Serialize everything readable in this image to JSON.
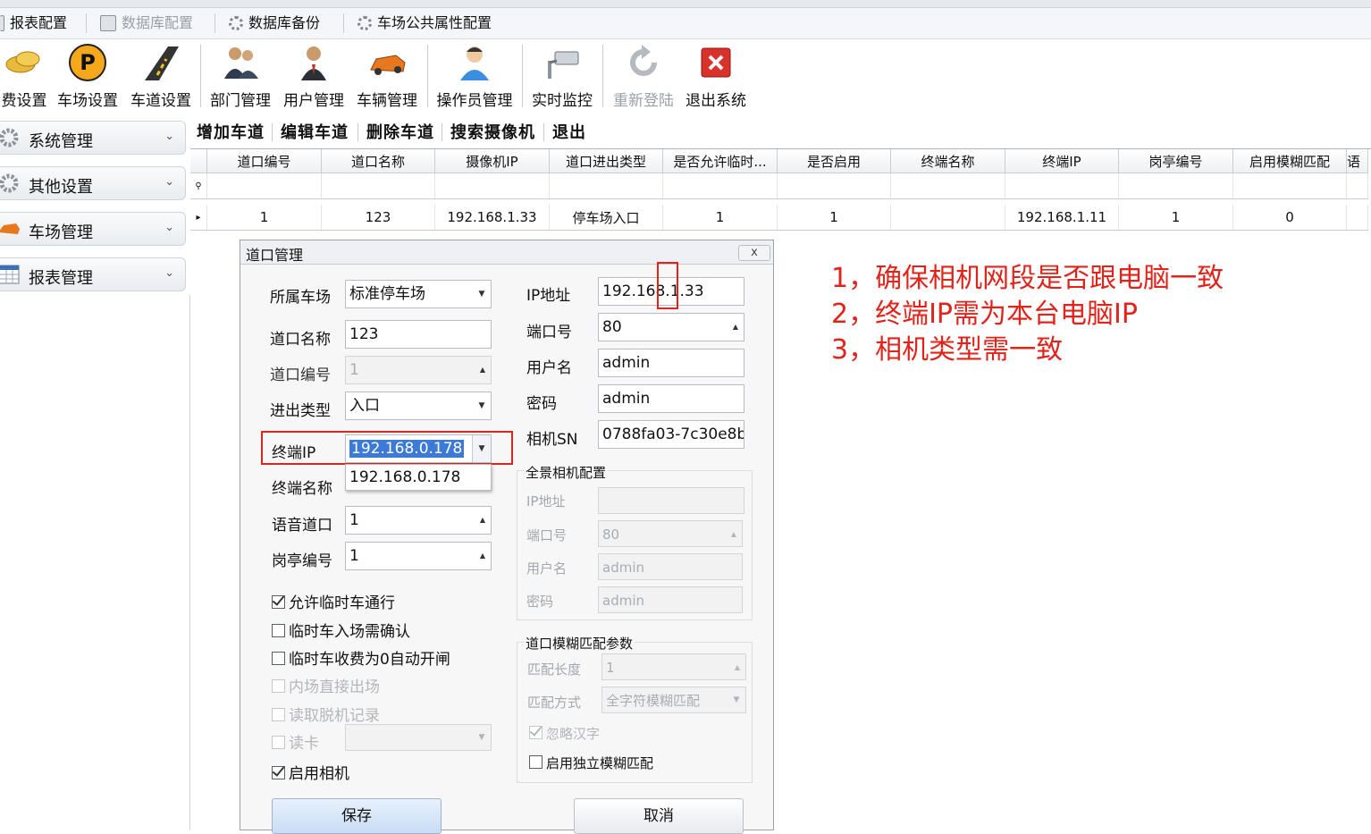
{
  "top_menu": {
    "report_config": "报表配置",
    "db_config": "数据库配置",
    "db_backup": "数据库备份",
    "lot_public_attr": "车场公共属性配置"
  },
  "toolbar": {
    "fee_settings": "费设置",
    "lot_settings": "车场设置",
    "lane_settings": "车道设置",
    "dept_mgmt": "部门管理",
    "user_mgmt": "用户管理",
    "vehicle_mgmt": "车辆管理",
    "operator_mgmt": "操作员管理",
    "realtime_monitor": "实时监控",
    "relogin": "重新登陆",
    "exit_system": "退出系统"
  },
  "sidebar": {
    "items": [
      {
        "label": "系统管理"
      },
      {
        "label": "其他设置"
      },
      {
        "label": "车场管理"
      },
      {
        "label": "报表管理"
      }
    ]
  },
  "grid_toolbar": {
    "add_lane": "增加车道",
    "edit_lane": "编辑车道",
    "delete_lane": "删除车道",
    "search_camera": "搜索摄像机",
    "exit": "退出"
  },
  "grid": {
    "columns": [
      "道口编号",
      "道口名称",
      "摄像机IP",
      "道口进出类型",
      "是否允许临时...",
      "是否启用",
      "终端名称",
      "终端IP",
      "岗亭编号",
      "启用模糊匹配",
      "语"
    ],
    "rows": [
      [
        "1",
        "123",
        "192.168.1.33",
        "停车场入口",
        "1",
        "1",
        "",
        "192.168.1.11",
        "1",
        "0",
        ""
      ]
    ]
  },
  "dialog": {
    "title": "道口管理",
    "close_label": "x",
    "left": {
      "parking_lot_label": "所属车场",
      "parking_lot_value": "标准停车场",
      "lane_name_label": "道口名称",
      "lane_name_value": "123",
      "lane_no_label": "道口编号",
      "lane_no_value": "1",
      "io_type_label": "进出类型",
      "io_type_value": "入口",
      "terminal_ip_label": "终端IP",
      "terminal_ip_value": "192.168.0.178",
      "terminal_ip_option": "192.168.0.178",
      "terminal_name_label": "终端名称",
      "voice_lane_label": "语音道口",
      "voice_lane_value": "1",
      "booth_no_label": "岗亭编号",
      "booth_no_value": "1",
      "chk_allow_temp": "允许临时车通行",
      "chk_temp_confirm": "临时车入场需确认",
      "chk_temp_zero_open": "临时车收费为0自动开闸",
      "chk_inner_exit": "内场直接出场",
      "chk_offline_records": "读取脱机记录",
      "chk_read_card": "读卡",
      "chk_enable_camera": "启用相机",
      "save_label": "保存"
    },
    "right": {
      "ip_label": "IP地址",
      "ip_value": "192.168.1.33",
      "port_label": "端口号",
      "port_value": "80",
      "user_label": "用户名",
      "user_value": "admin",
      "pwd_label": "密码",
      "pwd_value": "admin",
      "sn_label": "相机SN",
      "sn_value": "0788fa03-7c30e8b",
      "panorama_title": "全景相机配置",
      "pano_ip_label": "IP地址",
      "pano_ip_value": "",
      "pano_port_label": "端口号",
      "pano_port_value": "80",
      "pano_user_label": "用户名",
      "pano_user_value": "admin",
      "pano_pwd_label": "密码",
      "pano_pwd_value": "admin",
      "fuzzy_title": "道口模糊匹配参数",
      "match_len_label": "匹配长度",
      "match_len_value": "1",
      "match_mode_label": "匹配方式",
      "match_mode_value": "全字符模糊匹配",
      "chk_ignore_chinese": "忽略汉字",
      "chk_independent_fuzzy": "启用独立模糊匹配",
      "cancel_label": "取消"
    }
  },
  "annotations": {
    "line1": "1，确保相机网段是否跟电脑一致",
    "line2": "2，终端IP需为本台电脑IP",
    "line3": "3，相机类型需一致"
  },
  "colors": {
    "annotation_red": "#e0241b",
    "selection_blue": "#3d7ad6"
  }
}
